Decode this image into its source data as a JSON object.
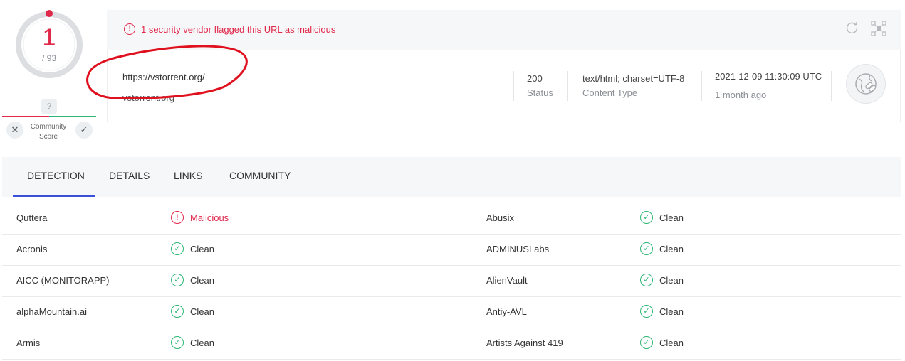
{
  "score": {
    "detections": "1",
    "total": "/ 93"
  },
  "community": {
    "badge": "?",
    "label_line1": "Community",
    "label_line2": "Score",
    "downvote": "✕",
    "upvote": "✓"
  },
  "banner": {
    "alert_icon": "!",
    "alert_text": "1 security vendor flagged this URL as malicious"
  },
  "info": {
    "url": "https://vstorrent.org/",
    "domain": "vstorrent.org",
    "status_value": "200",
    "status_label": "Status",
    "content_type_value": "text/html; charset=UTF-8",
    "content_type_label": "Content Type",
    "date_value": "2021-12-09 11:30:09 UTC",
    "date_relative": "1 month ago"
  },
  "tabs": [
    {
      "label": "DETECTION"
    },
    {
      "label": "DETAILS"
    },
    {
      "label": "LINKS"
    },
    {
      "label": "COMMUNITY"
    }
  ],
  "results": [
    {
      "left_vendor": "Quttera",
      "left_result": "Malicious",
      "right_vendor": "Abusix",
      "right_result": "Clean"
    },
    {
      "left_vendor": "Acronis",
      "left_result": "Clean",
      "right_vendor": "ADMINUSLabs",
      "right_result": "Clean"
    },
    {
      "left_vendor": "AICC (MONITORAPP)",
      "left_result": "Clean",
      "right_vendor": "AlienVault",
      "right_result": "Clean"
    },
    {
      "left_vendor": "alphaMountain.ai",
      "left_result": "Clean",
      "right_vendor": "Antiy-AVL",
      "right_result": "Clean"
    },
    {
      "left_vendor": "Armis",
      "left_result": "Clean",
      "right_vendor": "Artists Against 419",
      "right_result": "Clean"
    }
  ],
  "colors": {
    "malicious": "#e0284b",
    "clean": "#2bb673",
    "tab_accent": "#3b50d8"
  },
  "icons": {
    "clean": "check-circle-icon",
    "malicious": "exclamation-circle-icon",
    "reanalyze": "refresh-icon",
    "graph": "graph-icon",
    "url": "globe-link-icon"
  }
}
